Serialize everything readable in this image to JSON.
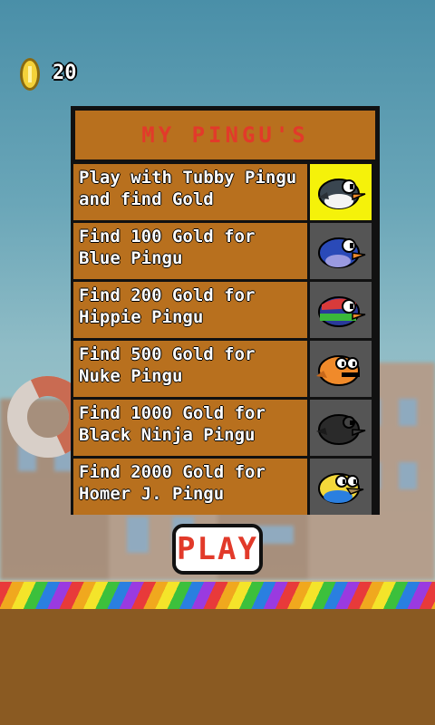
{
  "hud": {
    "coin_count": "20"
  },
  "panel": {
    "title": "MY PINGU'S",
    "items": [
      {
        "label": "Play with Tubby Pingu and find Gold",
        "bird": "tubby-pingu-icon",
        "selected": true
      },
      {
        "label": "Find 100 Gold for Blue Pingu",
        "bird": "blue-pingu-icon",
        "selected": false
      },
      {
        "label": "Find 200 Gold for Hippie Pingu",
        "bird": "hippie-pingu-icon",
        "selected": false
      },
      {
        "label": "Find 500 Gold for Nuke Pingu",
        "bird": "nuke-pingu-icon",
        "selected": false
      },
      {
        "label": "Find 1000 Gold for Black Ninja Pingu",
        "bird": "black-ninja-pingu-icon",
        "selected": false
      },
      {
        "label": "Find 2000 Gold for Homer J. Pingu",
        "bird": "homer-pingu-icon",
        "selected": false
      }
    ]
  },
  "play_button": {
    "label": "PLAY"
  },
  "colors": {
    "panel_brown": "#b8701e",
    "title_red": "#e23a2a",
    "selected_yellow": "#f5f20a",
    "ground_brown": "#8a5a22"
  }
}
